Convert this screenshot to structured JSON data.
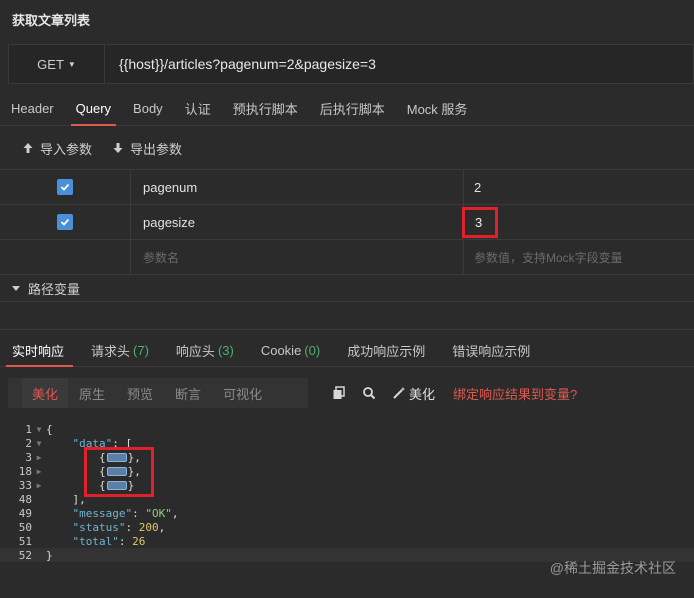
{
  "page_title": "获取文章列表",
  "request": {
    "method": "GET",
    "url": "{{host}}/articles?pagenum=2&pagesize=3"
  },
  "request_tabs": [
    {
      "label": "Header"
    },
    {
      "label": "Query"
    },
    {
      "label": "Body"
    },
    {
      "label": "认证"
    },
    {
      "label": "预执行脚本"
    },
    {
      "label": "后执行脚本"
    },
    {
      "label": "Mock 服务"
    }
  ],
  "param_actions": {
    "import": "导入参数",
    "export": "导出参数"
  },
  "params": [
    {
      "key": "pagenum",
      "value": "2"
    },
    {
      "key": "pagesize",
      "value": "3"
    }
  ],
  "param_placeholders": {
    "key": "参数名",
    "value": "参数值，支持Mock字段变量"
  },
  "path_vars_label": "路径变量",
  "response_tabs": [
    {
      "label": "实时响应",
      "count": ""
    },
    {
      "label": "请求头",
      "count": "(7)"
    },
    {
      "label": "响应头",
      "count": "(3)"
    },
    {
      "label": "Cookie",
      "count": "(0)"
    },
    {
      "label": "成功响应示例",
      "count": ""
    },
    {
      "label": "错误响应示例",
      "count": ""
    }
  ],
  "view_modes": [
    "美化",
    "原生",
    "预览",
    "断言",
    "可视化"
  ],
  "toolbar": {
    "beautify": "美化",
    "bind_result": "绑定响应结果到变量?"
  },
  "code_lines": [
    {
      "num": "1",
      "fold": "▼"
    },
    {
      "num": "2",
      "fold": "▼"
    },
    {
      "num": "3",
      "fold": "▶"
    },
    {
      "num": "18",
      "fold": "▶"
    },
    {
      "num": "33",
      "fold": "▶"
    },
    {
      "num": "48",
      "fold": ""
    },
    {
      "num": "49",
      "fold": ""
    },
    {
      "num": "50",
      "fold": ""
    },
    {
      "num": "51",
      "fold": ""
    },
    {
      "num": "52",
      "fold": ""
    }
  ],
  "code_tokens": {
    "open_brace": "{",
    "data_key": "\"data\"",
    "colon_bracket": ": [",
    "item_open": "{",
    "item_close_comma": "},",
    "item_close": "}",
    "close_bracket": "],",
    "message_key": "\"message\"",
    "message_val": "\"OK\"",
    "status_key": "\"status\"",
    "status_val": "200",
    "total_key": "\"total\"",
    "total_val": "26",
    "close_brace": "}"
  },
  "watermark": "@稀土掘金技术社区",
  "colors": {
    "accent": "#e0584f",
    "checkbox": "#4a8fd9",
    "highlight": "#e0212b",
    "count": "#4fae6b"
  }
}
